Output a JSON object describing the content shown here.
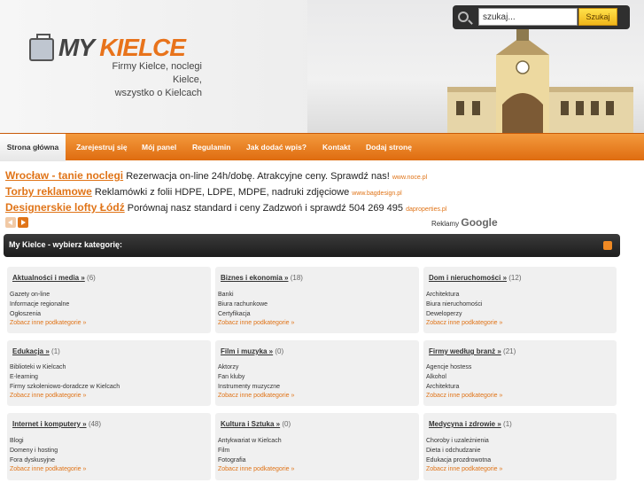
{
  "header": {
    "logo_my": "MY",
    "logo_kielce": "KIELCE",
    "tagline_line1": "Firmy Kielce, noclegi Kielce,",
    "tagline_line2": "wszystko o Kielcach"
  },
  "search": {
    "value": "szukaj...",
    "button_label": "Szukaj"
  },
  "nav": {
    "items": [
      "Strona główna",
      "Zarejestruj się",
      "Mój panel",
      "Regulamin",
      "Jak dodać wpis?",
      "Kontakt",
      "Dodaj stronę"
    ]
  },
  "ads": [
    {
      "title": "Wrocław - tanie noclegi",
      "desc": "Rezerwacja on-line 24h/dobę. Atrakcyjne ceny. Sprawdź nas!",
      "url": "www.noce.pl"
    },
    {
      "title": "Torby reklamowe",
      "desc": "Reklamówki z folii HDPE, LDPE, MDPE, nadruki zdjęciowe",
      "url": "www.bagdesign.pl"
    },
    {
      "title": "Designerskie lofty Łódź",
      "desc": "Porównaj nasz standard i ceny Zadzwoń i sprawdź 504 269 495",
      "url": "daproperties.pl"
    }
  ],
  "ads_footer": {
    "reklamy": "Reklamy",
    "google": "Google"
  },
  "categories_bar": {
    "title": "My Kielce - wybierz kategorię:"
  },
  "more_label": "Zobacz inne podkategorie »",
  "categories": [
    {
      "name": "Aktualności i media »",
      "count": "(6)",
      "items": [
        "Gazety on-line",
        "Informacje regionalne",
        "Ogłoszenia"
      ]
    },
    {
      "name": "Biznes i ekonomia »",
      "count": "(18)",
      "items": [
        "Banki",
        "Biura rachunkowe",
        "Certyfikacja"
      ]
    },
    {
      "name": "Dom i nieruchomości »",
      "count": "(12)",
      "items": [
        "Architektura",
        "Biura nieruchomości",
        "Deweloperzy"
      ]
    },
    {
      "name": "Edukacja »",
      "count": "(1)",
      "items": [
        "Biblioteki w Kielcach",
        "E-learning",
        "Firmy szkoleniowo-doradcze w Kielcach"
      ]
    },
    {
      "name": "Film i muzyka »",
      "count": "(0)",
      "items": [
        "Aktorzy",
        "Fan kluby",
        "Instrumenty muzyczne"
      ]
    },
    {
      "name": "Firmy według branż »",
      "count": "(21)",
      "items": [
        "Agencje hostess",
        "Alkohol",
        "Architektura"
      ]
    },
    {
      "name": "Internet i komputery »",
      "count": "(48)",
      "items": [
        "Blogi",
        "Domeny i hosting",
        "Fora dyskusyjne"
      ]
    },
    {
      "name": "Kultura i Sztuka »",
      "count": "(0)",
      "items": [
        "Antykwariat w Kielcach",
        "Film",
        "Fotografia"
      ]
    },
    {
      "name": "Medycyna i zdrowie »",
      "count": "(1)",
      "items": [
        "Choroby i uzależnienia",
        "Dieta i odchudzanie",
        "Edukacja prozdrowotna"
      ]
    }
  ]
}
